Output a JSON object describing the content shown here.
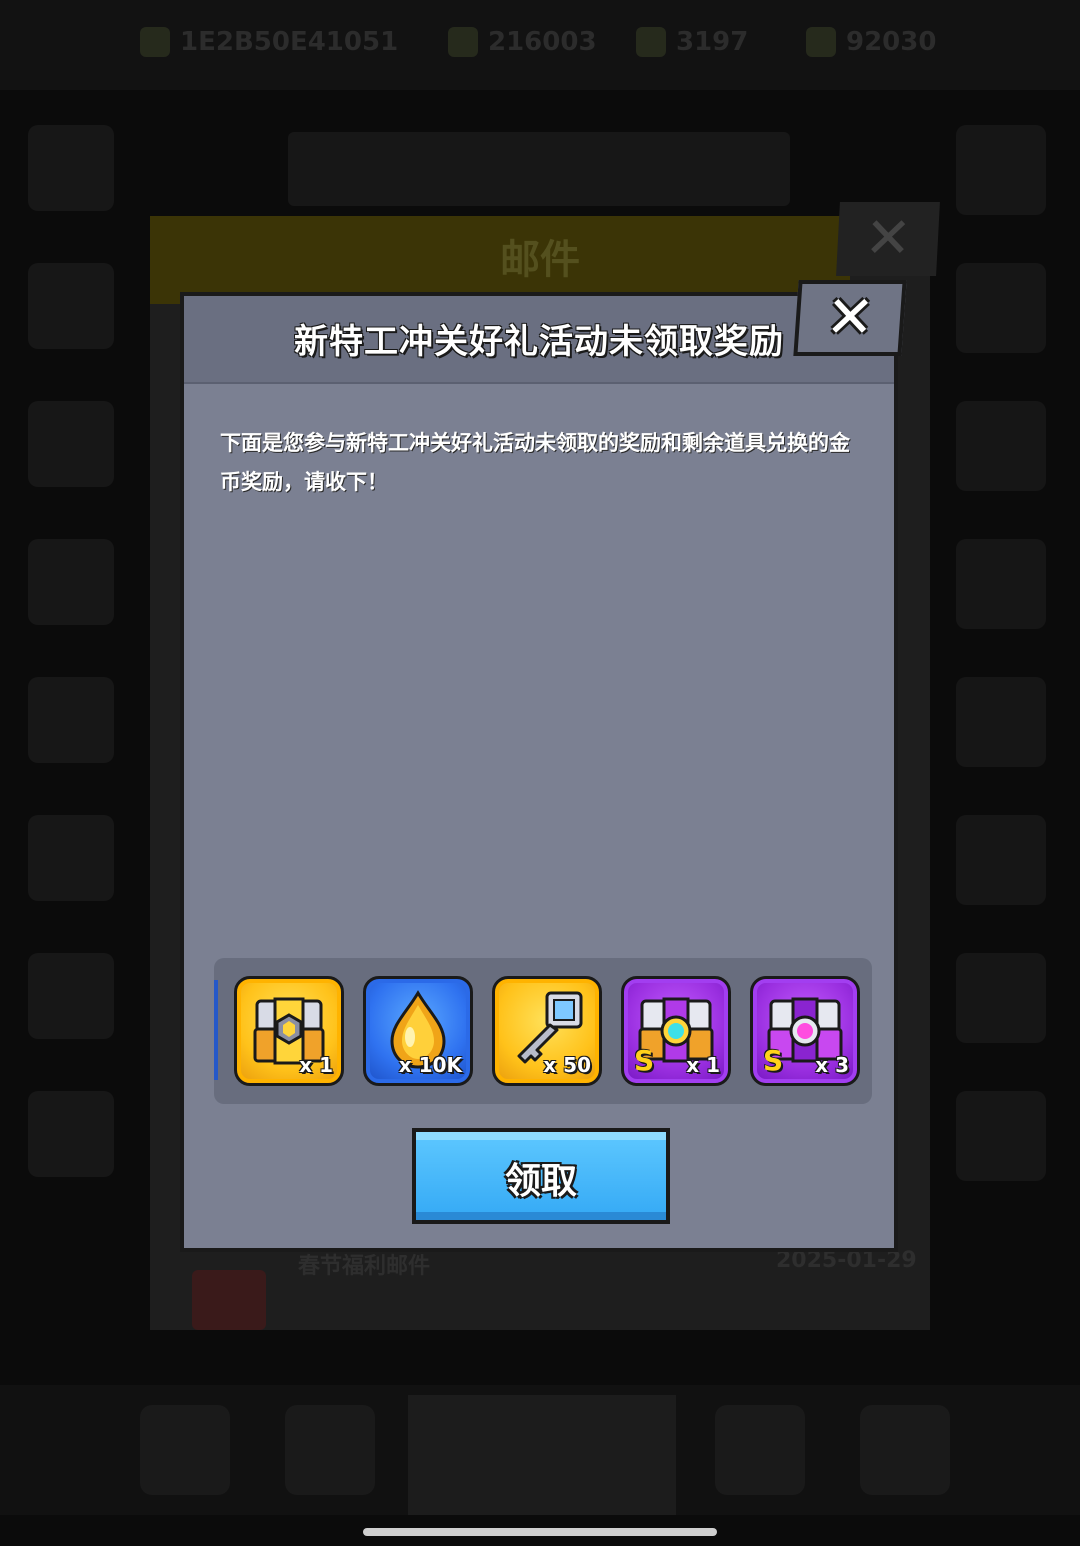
{
  "background": {
    "top_bar": {
      "id_text": "1E2B50E41051",
      "res1": "216003",
      "res2": "3197",
      "res3": "92030"
    },
    "mail_title": "邮件",
    "mail_item_title": "春节福利邮件",
    "mail_item_date": "2025-01-29"
  },
  "dialog": {
    "title": "新特工冲关好礼活动未领取奖励",
    "close_label": "✕",
    "message": "下面是您参与新特工冲关好礼活动未领取的奖励和剩余道具兑换的金币奖励，请收下！",
    "rewards": [
      {
        "name": "gold-chest-icon",
        "qty": "x 1",
        "rarity": "gold",
        "badge": ""
      },
      {
        "name": "fuel-drop-icon",
        "qty": "x 10K",
        "rarity": "blue",
        "badge": ""
      },
      {
        "name": "key-icon",
        "qty": "x 50",
        "rarity": "gold",
        "badge": ""
      },
      {
        "name": "s-chest-cyan-gem-icon",
        "qty": "x 1",
        "rarity": "purple",
        "badge": "S"
      },
      {
        "name": "s-chest-pink-gem-icon",
        "qty": "x 3",
        "rarity": "purple",
        "badge": "S"
      }
    ],
    "claim_label": "领取"
  },
  "colors": {
    "dialog_bg": "#7b8092",
    "button_blue": "#34a9f5",
    "gold": "#ffc21a",
    "purple": "#9a2fe0"
  }
}
